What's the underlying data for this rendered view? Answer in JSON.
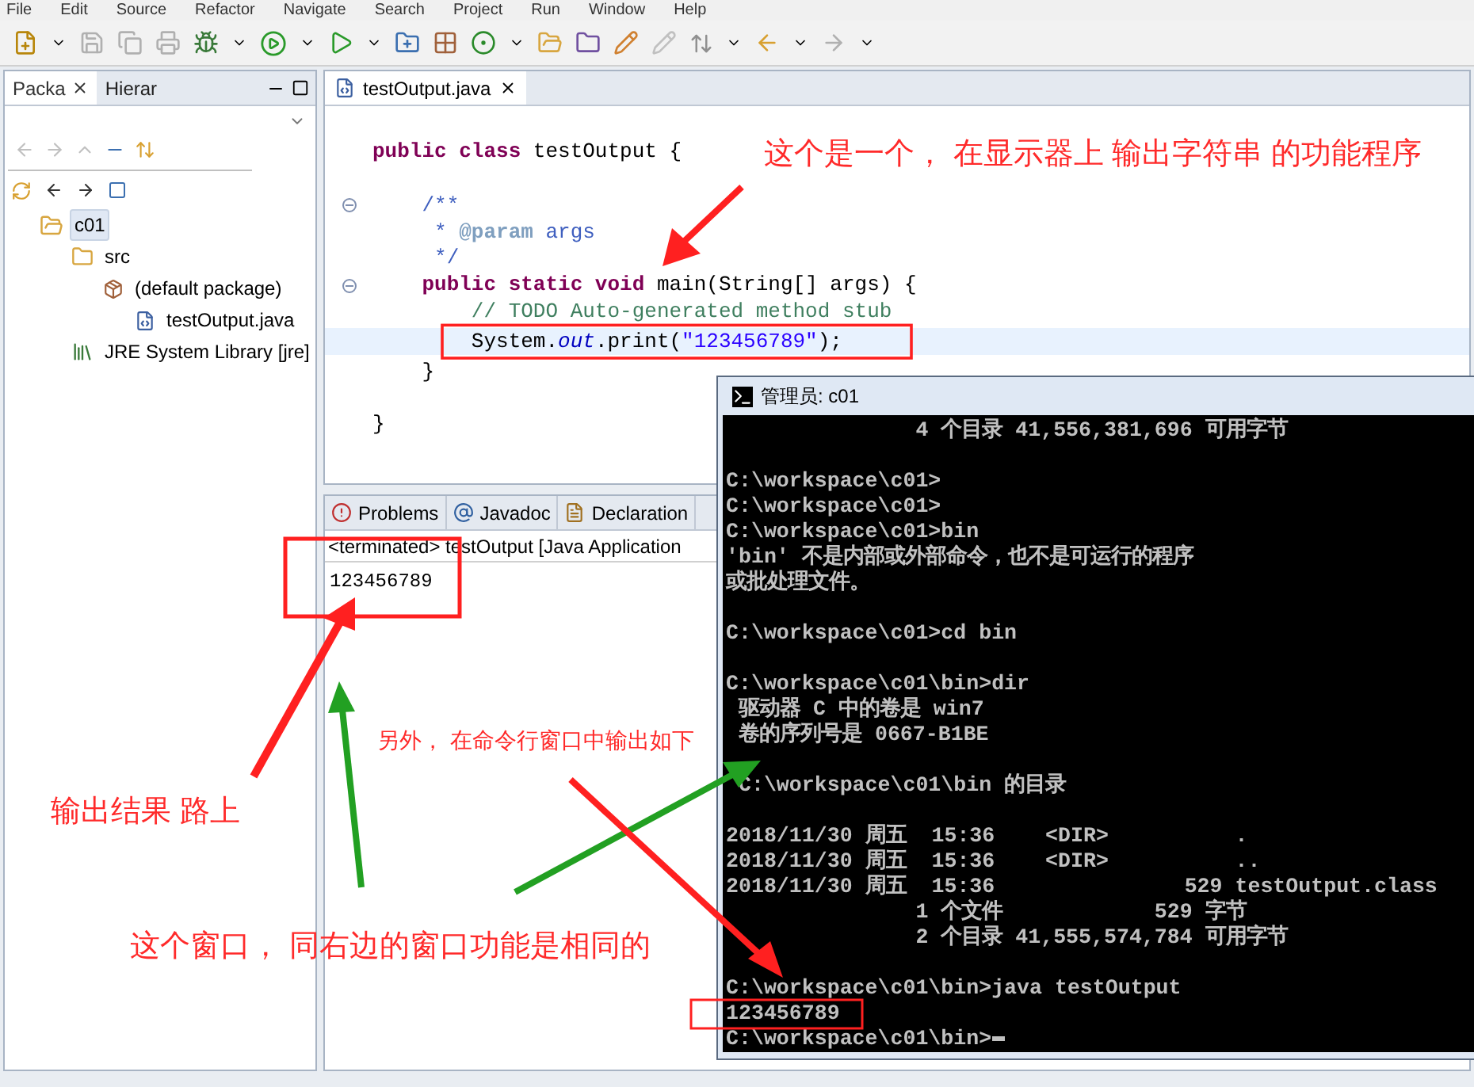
{
  "menu": [
    "File",
    "Edit",
    "Source",
    "Refactor",
    "Navigate",
    "Search",
    "Project",
    "Run",
    "Window",
    "Help"
  ],
  "left_tabs": [
    {
      "label": "Packa",
      "selected": true,
      "closable": true
    },
    {
      "label": "Hierar",
      "selected": false,
      "closable": false
    }
  ],
  "tree": [
    {
      "label": "c01",
      "kind": "project",
      "selected": true,
      "children": [
        {
          "label": "src",
          "kind": "source-folder",
          "selected": false,
          "children": [
            {
              "label": "(default package)",
              "kind": "package",
              "selected": false,
              "children": [
                {
                  "label": "testOutput.java",
                  "kind": "java-file",
                  "selected": false
                }
              ]
            }
          ]
        },
        {
          "label": "JRE System Library [jre]",
          "kind": "library",
          "selected": false
        }
      ]
    }
  ],
  "editor": {
    "tab": "testOutput.java",
    "lines": [
      {
        "kind": "blank"
      },
      {
        "kind": "code",
        "current": false,
        "fold": false,
        "tokens": [
          {
            "text": "public class ",
            "kind": "keyword"
          },
          {
            "text": "testOutput {",
            "kind": "plain"
          }
        ]
      },
      {
        "kind": "blank"
      },
      {
        "kind": "code",
        "current": false,
        "fold": true,
        "tokens": [
          {
            "text": "    /**",
            "kind": "javadoc"
          }
        ]
      },
      {
        "kind": "code",
        "current": false,
        "fold": false,
        "tokens": [
          {
            "text": "     * ",
            "kind": "javadoc"
          },
          {
            "text": "@param",
            "kind": "tag"
          },
          {
            "text": " args",
            "kind": "javadoc"
          }
        ]
      },
      {
        "kind": "code",
        "current": false,
        "fold": false,
        "tokens": [
          {
            "text": "     */",
            "kind": "javadoc"
          }
        ]
      },
      {
        "kind": "code",
        "current": false,
        "fold": true,
        "tokens": [
          {
            "text": "    public static void ",
            "kind": "keyword"
          },
          {
            "text": "main(String[] args) {",
            "kind": "plain"
          }
        ]
      },
      {
        "kind": "code",
        "current": false,
        "fold": false,
        "tokens": [
          {
            "text": "        // TODO Auto-generated method stub",
            "kind": "comment"
          }
        ]
      },
      {
        "kind": "code",
        "current": true,
        "fold": false,
        "tokens": [
          {
            "text": "        System.",
            "kind": "plain"
          },
          {
            "text": "out",
            "kind": "field"
          },
          {
            "text": ".print(",
            "kind": "plain"
          },
          {
            "text": "\"123456789\"",
            "kind": "string"
          },
          {
            "text": ");",
            "kind": "plain"
          }
        ]
      },
      {
        "kind": "code",
        "current": false,
        "fold": false,
        "tokens": [
          {
            "text": "    }",
            "kind": "plain"
          }
        ]
      },
      {
        "kind": "blank"
      },
      {
        "kind": "code",
        "current": false,
        "fold": false,
        "tokens": [
          {
            "text": "}",
            "kind": "plain"
          }
        ]
      }
    ]
  },
  "bottom_tabs": [
    {
      "label": "Problems",
      "kind": "problems",
      "selected": false
    },
    {
      "label": "Javadoc",
      "kind": "javadoc",
      "selected": false
    },
    {
      "label": "Declaration",
      "kind": "declaration",
      "selected": false
    }
  ],
  "console": {
    "header": "<terminated> testOutput [Java Application",
    "output": "123456789"
  },
  "cmd": {
    "title": "管理员: c01",
    "lines": [
      {
        "kind": "text",
        "text": "               4 个目录 41,556,381,696 可用字节"
      },
      {
        "kind": "blank"
      },
      {
        "kind": "text",
        "text": "C:\\workspace\\c01>"
      },
      {
        "kind": "text",
        "text": "C:\\workspace\\c01>"
      },
      {
        "kind": "text",
        "text": "C:\\workspace\\c01>bin"
      },
      {
        "kind": "text",
        "text": "'bin' 不是内部或外部命令，也不是可运行的程序"
      },
      {
        "kind": "text",
        "text": "或批处理文件。"
      },
      {
        "kind": "blank"
      },
      {
        "kind": "text",
        "text": "C:\\workspace\\c01>cd bin"
      },
      {
        "kind": "blank"
      },
      {
        "kind": "text",
        "text": "C:\\workspace\\c01\\bin>dir"
      },
      {
        "kind": "text",
        "text": " 驱动器 C 中的卷是 win7"
      },
      {
        "kind": "text",
        "text": " 卷的序列号是 0667-B1BE"
      },
      {
        "kind": "blank"
      },
      {
        "kind": "text",
        "text": " C:\\workspace\\c01\\bin 的目录"
      },
      {
        "kind": "blank"
      },
      {
        "kind": "text",
        "text": "2018/11/30 周五  15:36    <DIR>          ."
      },
      {
        "kind": "text",
        "text": "2018/11/30 周五  15:36    <DIR>          .."
      },
      {
        "kind": "text",
        "text": "2018/11/30 周五  15:36               529 testOutput.class"
      },
      {
        "kind": "text",
        "text": "               1 个文件            529 字节"
      },
      {
        "kind": "text",
        "text": "               2 个目录 41,555,574,784 可用字节"
      },
      {
        "kind": "blank"
      },
      {
        "kind": "text",
        "text": "C:\\workspace\\c01\\bin>java testOutput"
      },
      {
        "kind": "text",
        "text": "123456789"
      },
      {
        "kind": "text",
        "text": "C:\\workspace\\c01\\bin>",
        "cursor": true
      }
    ]
  },
  "annotations": [
    {
      "text": "这个是一个， 在显示器上 输出字符串 的功能程序"
    },
    {
      "text": "另外， 在命令行窗口中输出如下"
    },
    {
      "text": "输出结果 路上"
    },
    {
      "text": "这个窗口， 同右边的窗口功能是相同的"
    }
  ]
}
